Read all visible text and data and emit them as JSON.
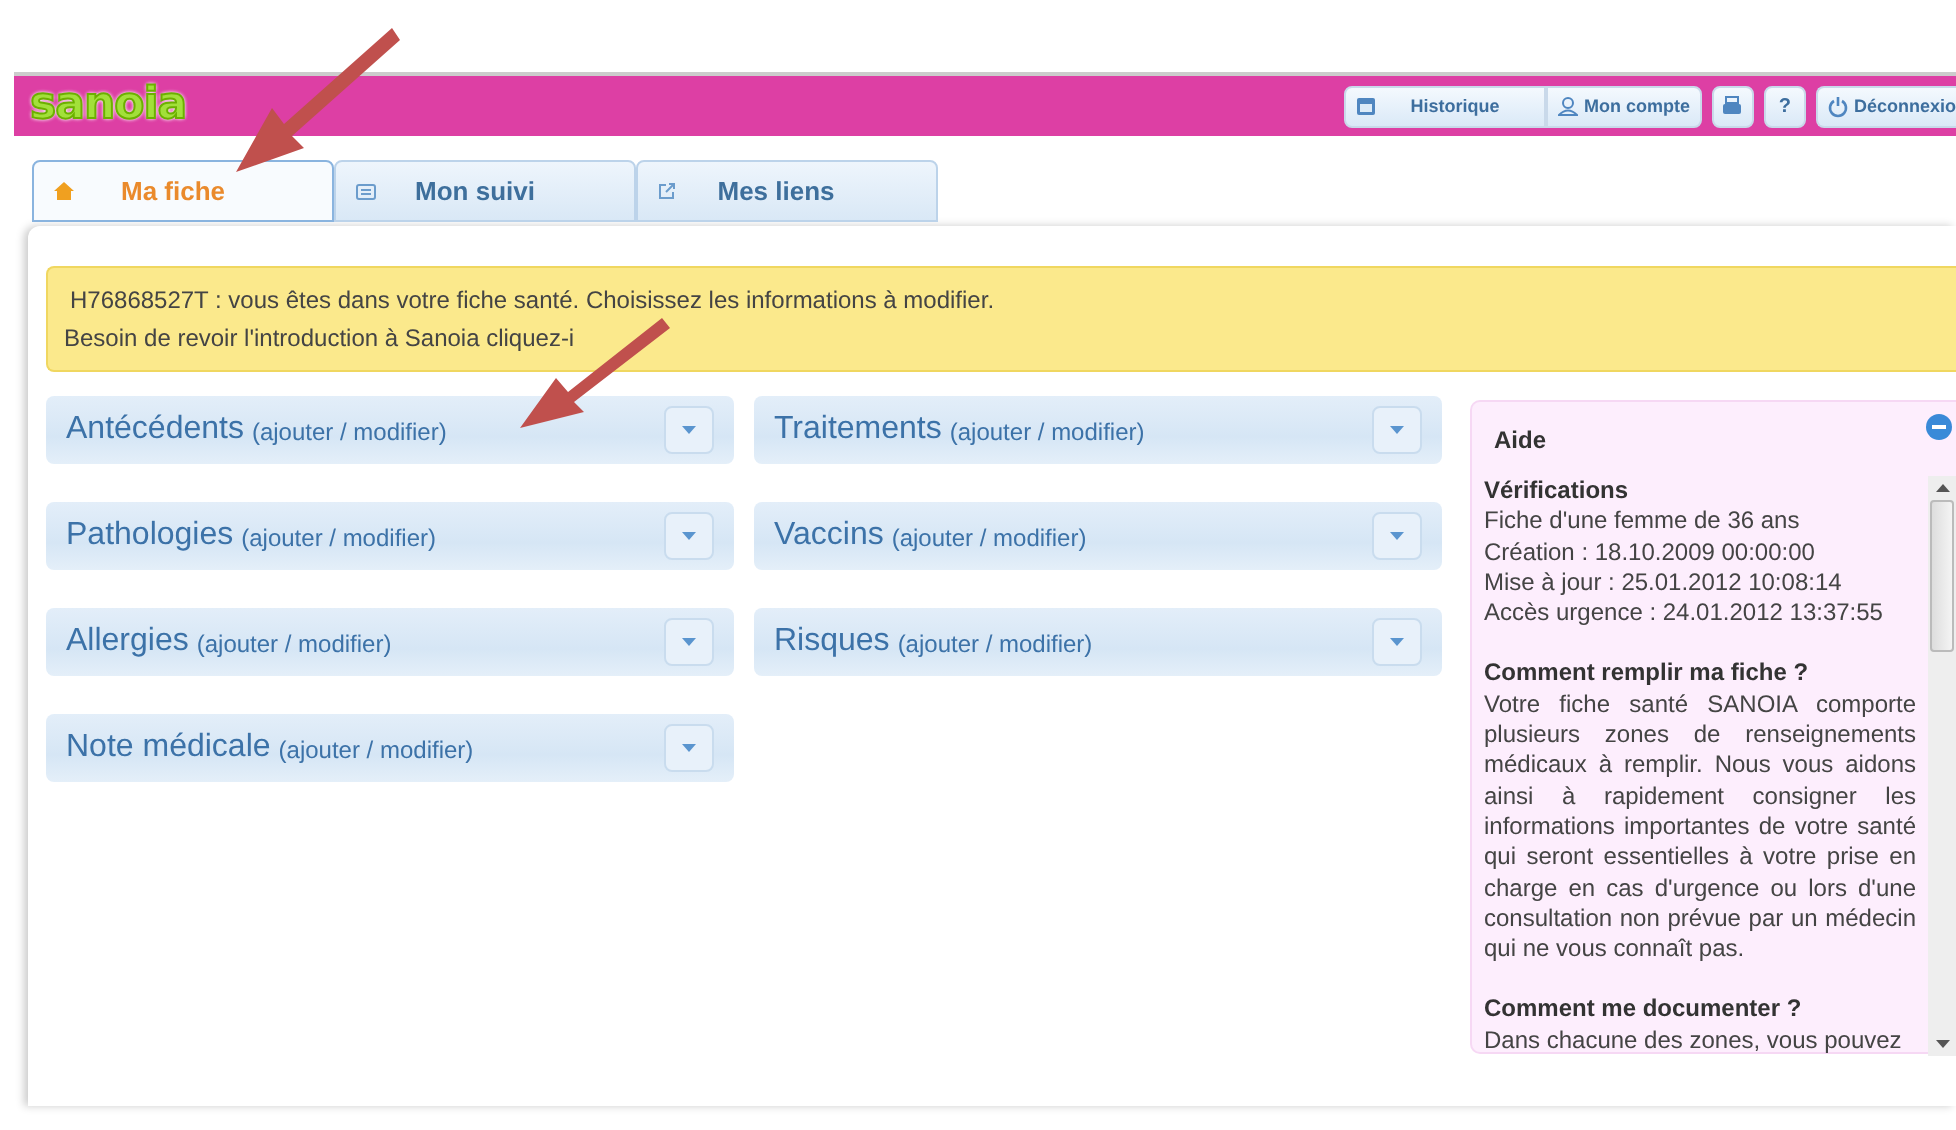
{
  "header": {
    "logo": "sanoia",
    "buttons": [
      {
        "kind": "history",
        "label": "Historique"
      },
      {
        "kind": "account",
        "label": "Mon compte"
      },
      {
        "kind": "print"
      },
      {
        "kind": "help",
        "label": "?"
      },
      {
        "kind": "logout",
        "label": "Déconnexio"
      }
    ]
  },
  "tabs": [
    {
      "kind": "home",
      "label": "Ma fiche",
      "selected": true
    },
    {
      "kind": "monitor",
      "label": "Mon suivi",
      "selected": false
    },
    {
      "kind": "links",
      "label": "Mes liens",
      "selected": false
    }
  ],
  "notice": {
    "lines": [
      "H76868527T : vous êtes dans votre fiche santé. Choisissez les informations à modifier.",
      "Besoin de revoir l'introduction à Sanoia cliquez-i"
    ]
  },
  "sections": [
    {
      "title": "Antécédents",
      "action": "(ajouter / modifier)"
    },
    {
      "title": "Traitements",
      "action": "(ajouter / modifier)"
    },
    {
      "title": "Pathologies",
      "action": "(ajouter / modifier)"
    },
    {
      "title": "Vaccins",
      "action": "(ajouter / modifier)"
    },
    {
      "title": "Allergies",
      "action": "(ajouter / modifier)"
    },
    {
      "title": "Risques",
      "action": "(ajouter / modifier)"
    },
    {
      "title": "Note médicale",
      "action": "(ajouter / modifier)"
    }
  ],
  "help": {
    "title": "Aide",
    "blocks": [
      {
        "kind": "lines",
        "heading": "Vérifications",
        "lines": [
          "Fiche d'une femme de 36 ans",
          "Création : 18.10.2009 00:00:00",
          "Mise à jour : 25.01.2012 10:08:14",
          "Accès urgence : 24.01.2012 13:37:55"
        ]
      },
      {
        "kind": "paragraph",
        "heading": "Comment remplir ma fiche ?",
        "text": "Votre fiche santé SANOIA comporte plusieurs zones de renseignements médicaux à remplir. Nous vous aidons ainsi à rapidement consigner les informations importantes de votre santé qui seront essentielles à votre prise en charge en cas d'urgence ou lors d'une consultation non prévue par un médecin qui ne vous connaît pas."
      },
      {
        "kind": "paragraph",
        "heading": "Comment me documenter ?",
        "text": "Dans chacune des zones, vous pouvez"
      }
    ]
  }
}
